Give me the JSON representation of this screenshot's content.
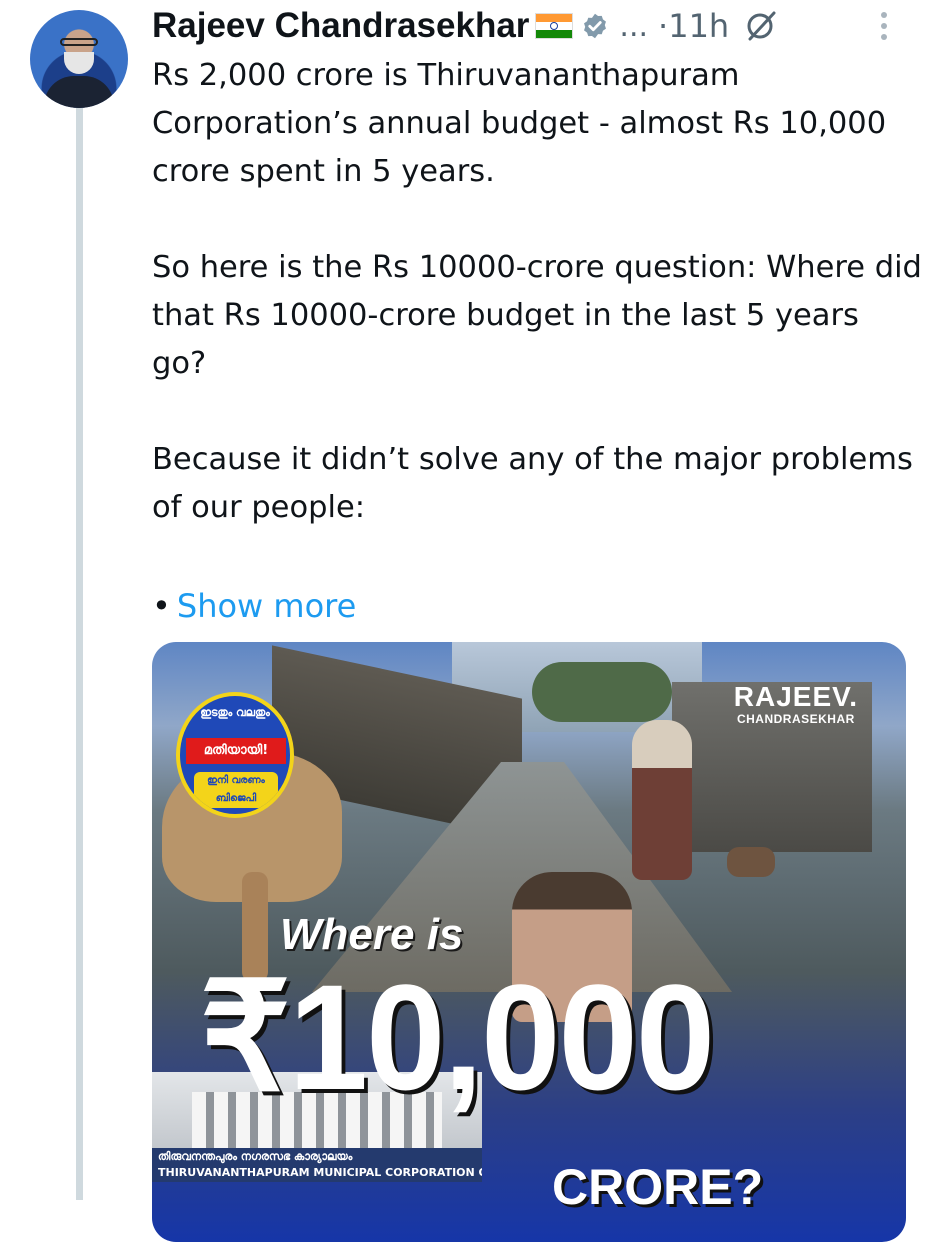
{
  "author": {
    "name": "Rajeev Chandrasekhar",
    "more": "...",
    "time": "·11h"
  },
  "tweet": {
    "paragraphs": [
      "Rs 2,000 crore is Thiruvananthapuram Corporation’s annual budget - almost Rs 10,000 crore spent in 5 years.",
      "So here is the Rs 10000-crore question: Where did that Rs 10000-crore budget in the last 5 years go?",
      "Because it didn’t solve any of the major problems of our people:"
    ],
    "show_more": "Show more",
    "bullet": "•"
  },
  "media": {
    "badge_arc": "ഇടതും വലതും",
    "badge_ribbon": "മതിയായി!",
    "badge_sub_1": "ഇനി വരണം",
    "badge_sub_2": "ബിജെപി",
    "brand_line1": "RAJEEV.",
    "brand_line2": "CHANDRASEKHAR",
    "headline": "Where is",
    "amount": "₹10,000",
    "crore": "CRORE?",
    "office_malayalam": "തിരുവനന്തപുരം നഗരസഭ കാര്യാലയം",
    "office_english": "THIRUVANANTHAPURAM MUNICIPAL CORPORATION OFFICE"
  },
  "colors": {
    "link": "#1d9bf0",
    "meta": "#536471",
    "thread_line": "#cfd9de",
    "flag_saffron": "#ff9933",
    "flag_green": "#138808"
  },
  "icons": [
    "flag-india-icon",
    "verified-icon",
    "grok-icon",
    "more-options-icon"
  ]
}
